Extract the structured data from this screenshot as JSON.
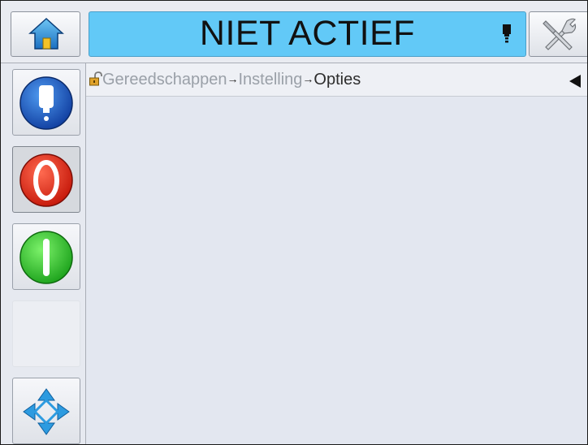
{
  "header": {
    "status": "NIET ACTIEF",
    "status_color": "#62c9f7",
    "home_icon": "home-icon",
    "ink_icon": "ink-cartridge-icon",
    "tools_icon": "tools-wrench-screwdriver-icon"
  },
  "sidebar": {
    "items": [
      {
        "name": "ink-cartridge-button",
        "icon": "ink-drop-icon",
        "color": "#1f5fd6"
      },
      {
        "name": "stop-button",
        "icon": "stop-icon",
        "color": "#e3261a"
      },
      {
        "name": "start-button",
        "icon": "start-icon",
        "color": "#2fcf2a"
      },
      {
        "name": "empty-slot",
        "icon": ""
      },
      {
        "name": "navigation-button",
        "icon": "navigation-arrows-icon",
        "color": "#2d9be0"
      }
    ]
  },
  "breadcrumb": {
    "lock_icon": "unlocked-padlock-icon",
    "items": [
      "Gereedschappen",
      "Instelling",
      "Opties"
    ],
    "separator": "→",
    "collapse_icon": "collapse-left-icon"
  }
}
